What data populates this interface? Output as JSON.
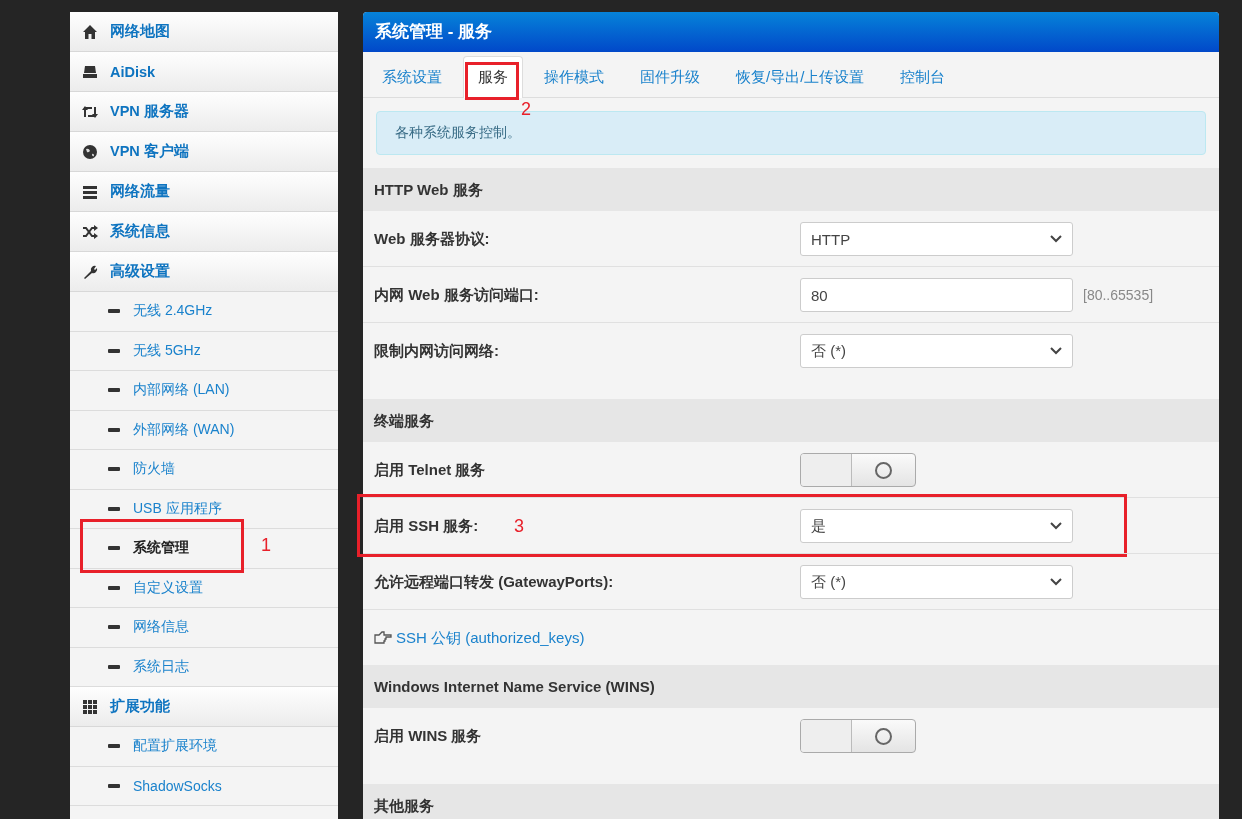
{
  "sidebar": {
    "items": [
      {
        "kind": "main",
        "label": "网络地图",
        "selected": false
      },
      {
        "kind": "main",
        "label": "AiDisk",
        "selected": false
      },
      {
        "kind": "main",
        "label": "VPN 服务器",
        "selected": false
      },
      {
        "kind": "main",
        "label": "VPN 客户端",
        "selected": false
      },
      {
        "kind": "main",
        "label": "网络流量",
        "selected": false
      },
      {
        "kind": "main",
        "label": "系统信息",
        "selected": false
      },
      {
        "kind": "main",
        "label": "高级设置",
        "selected": false
      },
      {
        "kind": "sub",
        "label": "无线 2.4GHz",
        "selected": false
      },
      {
        "kind": "sub",
        "label": "无线 5GHz",
        "selected": false
      },
      {
        "kind": "sub",
        "label": "内部网络 (LAN)",
        "selected": false
      },
      {
        "kind": "sub",
        "label": "外部网络 (WAN)",
        "selected": false
      },
      {
        "kind": "sub",
        "label": "防火墙",
        "selected": false
      },
      {
        "kind": "sub",
        "label": "USB 应用程序",
        "selected": false
      },
      {
        "kind": "sub",
        "label": "系统管理",
        "selected": true,
        "callout": "1"
      },
      {
        "kind": "sub",
        "label": "自定义设置",
        "selected": false
      },
      {
        "kind": "sub",
        "label": "网络信息",
        "selected": false
      },
      {
        "kind": "sub",
        "label": "系统日志",
        "selected": false
      },
      {
        "kind": "main",
        "label": "扩展功能",
        "selected": false
      },
      {
        "kind": "sub",
        "label": "配置扩展环境",
        "selected": false
      },
      {
        "kind": "sub",
        "label": "ShadowSocks",
        "selected": false
      },
      {
        "kind": "sub"
      }
    ]
  },
  "main": {
    "title": "系统管理 - 服务",
    "tabs": [
      {
        "label": "系统设置",
        "selected": false
      },
      {
        "label": "服务",
        "selected": true,
        "callout": "2"
      },
      {
        "label": "操作模式",
        "selected": false
      },
      {
        "label": "固件升级",
        "selected": false
      },
      {
        "label": "恢复/导出/上传设置",
        "selected": false
      },
      {
        "label": "控制台",
        "selected": false
      }
    ],
    "info": "各种系统服务控制。",
    "sections": [
      {
        "title": "HTTP Web 服务",
        "rows": [
          {
            "kind": "select",
            "label": "Web 服务器协议:",
            "value": "HTTP"
          },
          {
            "kind": "input",
            "label": "内网 Web 服务访问端口:",
            "value": "80",
            "hint": "[80..65535]"
          },
          {
            "kind": "select",
            "label": "限制内网访问网络:",
            "value": "否 (*)"
          }
        ]
      },
      {
        "title": "终端服务",
        "rows": [
          {
            "kind": "toggle",
            "label": "启用 Telnet 服务",
            "on": false
          },
          {
            "kind": "select",
            "label": "启用 SSH 服务:",
            "value": "是",
            "callout": "3"
          },
          {
            "kind": "select",
            "label": "允许远程端口转发 (GatewayPorts):",
            "value": "否 (*)"
          },
          {
            "kind": "link",
            "label": "SSH 公钥 (authorized_keys)"
          }
        ]
      },
      {
        "title": "Windows Internet Name Service (WINS)",
        "rows": [
          {
            "kind": "toggle",
            "label": "启用 WINS 服务",
            "on": false
          }
        ]
      },
      {
        "title": "其他服务"
      }
    ]
  }
}
